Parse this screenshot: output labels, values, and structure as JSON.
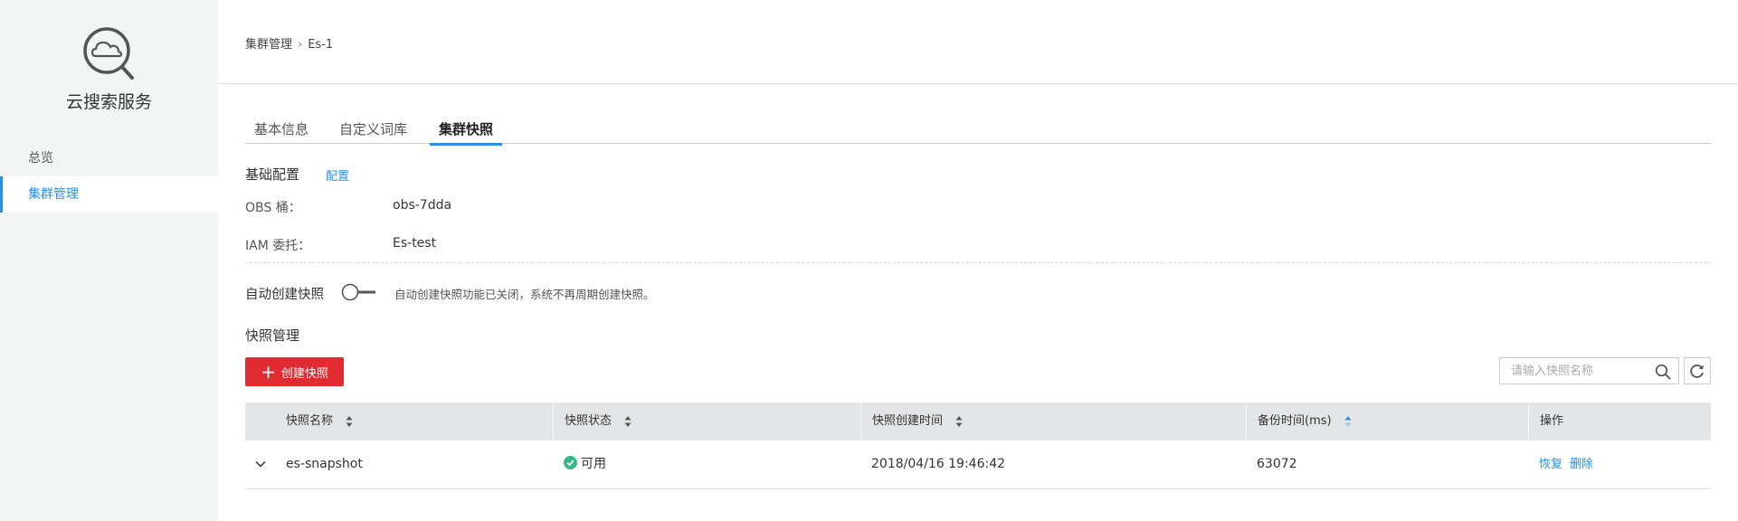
{
  "sidebar": {
    "logo_icon": "cloud-search-icon",
    "brand_title": "云搜索服务",
    "items": [
      {
        "label": "总览"
      },
      {
        "label": "集群管理",
        "active": true
      }
    ]
  },
  "breadcrumb": {
    "parent": "集群管理",
    "current": "Es-1"
  },
  "tabs": [
    {
      "label": "基本信息"
    },
    {
      "label": "自定义词库"
    },
    {
      "label": "集群快照",
      "active": true
    }
  ],
  "basic_config": {
    "title": "基础配置",
    "config_link": "配置",
    "fields": [
      {
        "label": "OBS 桶：",
        "value": "obs-7dda"
      },
      {
        "label": "IAM 委托：",
        "value": "Es-test"
      }
    ]
  },
  "auto_snapshot": {
    "label": "自动创建快照",
    "enabled": false,
    "hint": "自动创建快照功能已关闭，系统不再周期创建快照。"
  },
  "snapshot_mgmt": {
    "title": "快照管理",
    "create_button": "创建快照",
    "search_placeholder": "请输入快照名称",
    "columns": [
      "快照名称",
      "快照状态",
      "快照创建时间",
      "备份时间(ms)",
      "操作"
    ],
    "rows": [
      {
        "name": "es-snapshot",
        "status": "可用",
        "created": "2018/04/16 19:46:42",
        "backup_ms": "63072",
        "actions": [
          "恢复",
          "删除"
        ]
      }
    ]
  },
  "colors": {
    "accent": "#2b8fe3",
    "danger": "#e02b30",
    "success": "#34b989"
  }
}
